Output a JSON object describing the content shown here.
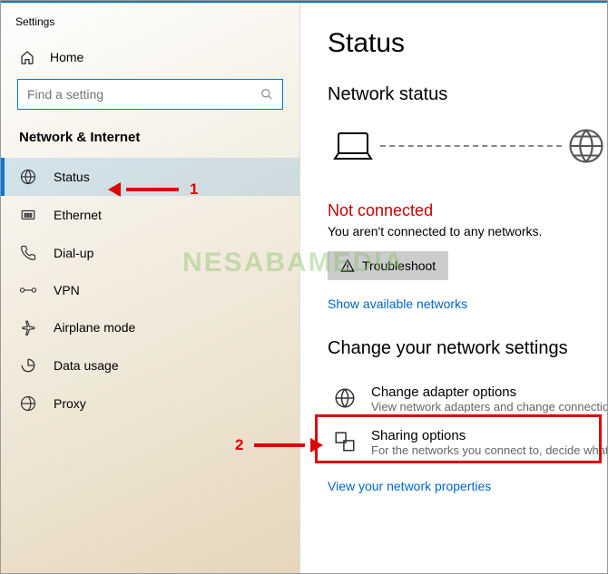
{
  "app_title": "Settings",
  "home_label": "Home",
  "search": {
    "placeholder": "Find a setting"
  },
  "section_title": "Network & Internet",
  "sidebar": {
    "items": [
      {
        "label": "Status"
      },
      {
        "label": "Ethernet"
      },
      {
        "label": "Dial-up"
      },
      {
        "label": "VPN"
      },
      {
        "label": "Airplane mode"
      },
      {
        "label": "Data usage"
      },
      {
        "label": "Proxy"
      }
    ]
  },
  "main": {
    "title": "Status",
    "net_status_head": "Network status",
    "not_connected": "Not connected",
    "not_connected_desc": "You aren't connected to any networks.",
    "troubleshoot": "Troubleshoot",
    "show_networks": "Show available networks",
    "change_head": "Change your network settings",
    "opt1_label": "Change adapter options",
    "opt1_desc": "View network adapters and change connection set",
    "opt2_label": "Sharing options",
    "opt2_desc": "For the networks you connect to, decide what you",
    "view_props": "View your network properties"
  },
  "annotations": {
    "num1": "1",
    "num2": "2"
  },
  "watermark": "NESABAMEDIA"
}
